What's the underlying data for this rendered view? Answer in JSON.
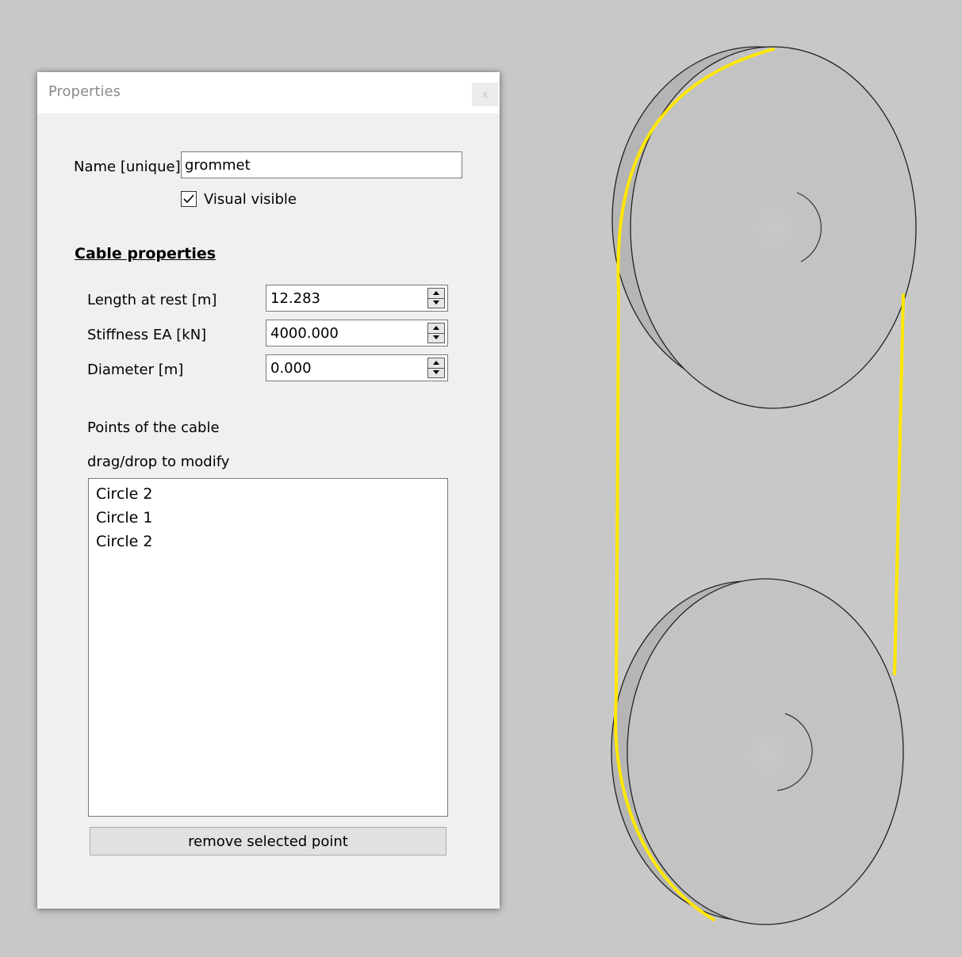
{
  "window": {
    "title": "Properties",
    "close_label": "x"
  },
  "name_row": {
    "label": "Name [unique]",
    "value": "grommet"
  },
  "visual_visible": {
    "label": "Visual visible",
    "checked": true
  },
  "cable": {
    "section_title": "Cable properties",
    "length": {
      "label": "Length at rest [m]",
      "value": "12.283"
    },
    "stiffness": {
      "label": "Stiffness EA [kN]",
      "value": "4000.000"
    },
    "diameter": {
      "label": "Diameter [m]",
      "value": "0.000"
    }
  },
  "points": {
    "heading": "Points of the cable",
    "hint": "drag/drop to modify",
    "items": [
      "Circle 2",
      "Circle 1",
      "Circle 2"
    ],
    "remove_label": "remove selected point"
  },
  "colors": {
    "background": "#c8c8c8",
    "cable": "#ffe800",
    "sheave": "#c2c2c2"
  }
}
